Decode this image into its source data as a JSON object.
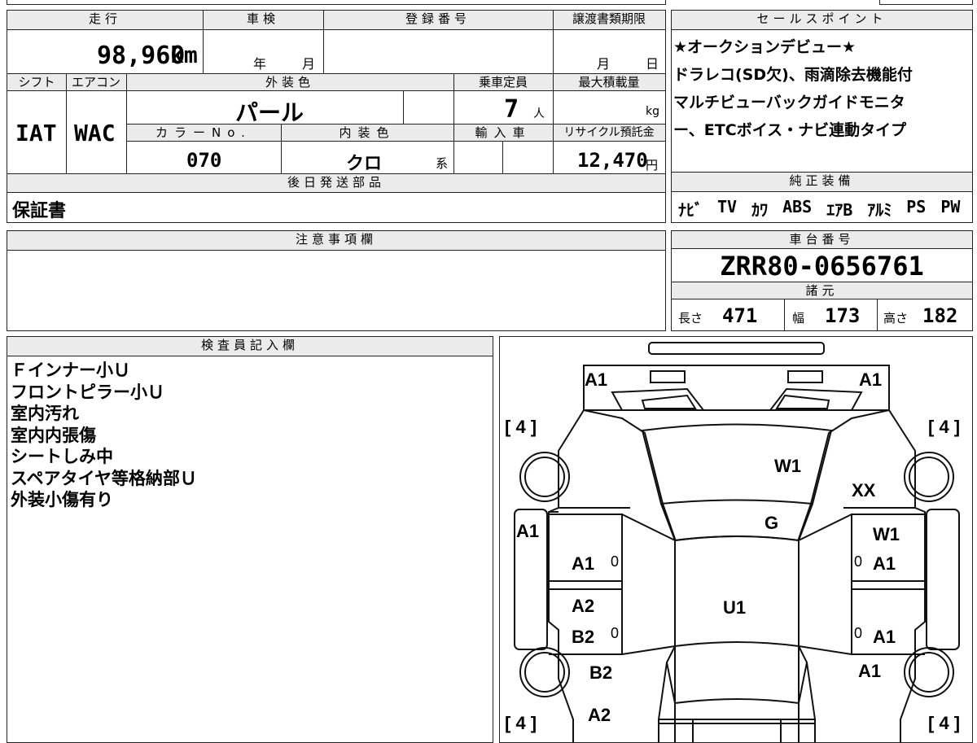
{
  "headers": {
    "mileage": "走行",
    "shaken": "車検",
    "registration": "登録番号",
    "transfer_deadline": "譲渡書類期限",
    "shift": "シフト",
    "aircon": "エアコン",
    "exterior_color": "外装色",
    "capacity": "乗車定員",
    "max_load": "最大積載量",
    "color_no": "カラーNo.",
    "interior_color": "内装色",
    "import": "輸入車",
    "recycle": "リサイクル預託金",
    "later_parts": "後日発送部品",
    "sales_point": "セールスポイント",
    "equipment": "純正装備",
    "caution": "注意事項欄",
    "chassis": "車台番号",
    "specs": "諸元",
    "inspector": "検査員記入欄"
  },
  "vehicle": {
    "mileage": "98,960",
    "mileage_unit": "km",
    "shaken_year_unit": "年",
    "shaken_month_unit": "月",
    "transfer_month_unit": "月",
    "transfer_day_unit": "日",
    "shift": "IAT",
    "aircon": "WAC",
    "exterior_color": "パール",
    "capacity": "7",
    "capacity_unit": "人",
    "max_load_unit": "kg",
    "color_no": "070",
    "interior_color": "クロ",
    "interior_suffix": "系",
    "recycle_fee": "12,470",
    "recycle_unit": "円",
    "later_parts": "保証書",
    "chassis_no": "ZRR80-0656761"
  },
  "sales_points": [
    "★オークションデビュー★",
    "ドラレコ(SD欠)、雨滴除去機能付",
    "マルチビューバックガイドモニタ",
    "ー、ETCボイス・ナビ連動タイプ"
  ],
  "equipment": [
    "ﾅﾋﾞ",
    "TV",
    "ｶﾜ",
    "ABS",
    "ｴｱB",
    "ｱﾙﾐ",
    "PS",
    "PW"
  ],
  "specs": {
    "length_label": "長さ",
    "length": "471",
    "width_label": "幅",
    "width": "173",
    "height_label": "高さ",
    "height": "182"
  },
  "inspector_notes": [
    "Ｆインナー小Ｕ",
    "フロントピラー小Ｕ",
    "室内汚れ",
    "室内内張傷",
    "シートしみ中",
    "スペアタイヤ等格納部Ｕ",
    "外装小傷有り"
  ],
  "diagram": {
    "marks": {
      "front_left": "A1",
      "front_right": "A1",
      "tire_fl": "[ 4 ]",
      "tire_fr": "[ 4 ]",
      "tire_rl": "[ 4 ]",
      "tire_rr": "[ 4 ]",
      "windshield": "W1",
      "right_fender": "XX",
      "hood_g": "G",
      "left_side": "A1",
      "right_window": "W1",
      "left_front_door": "A1",
      "right_front_door": "A1",
      "left_rear_door_a": "A2",
      "left_rear_door_b": "B2",
      "right_rear_door": "A1",
      "roof": "U1",
      "left_rear_fender": "B2",
      "right_rear_fender": "A1",
      "rear": "A2",
      "z1": "0",
      "z2": "0",
      "z3": "0",
      "z4": "0"
    }
  }
}
